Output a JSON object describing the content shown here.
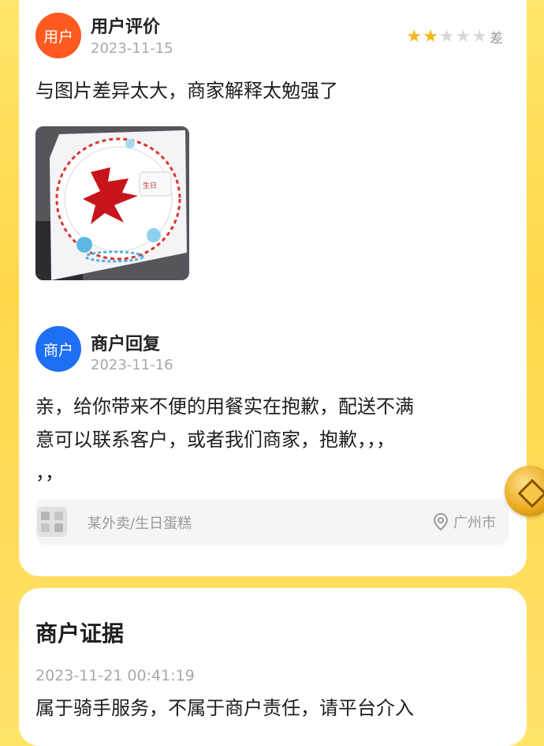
{
  "review": {
    "header": "用户评价",
    "avatar_label": "用户",
    "date": "2023-11-15",
    "rating": 2,
    "rating_max": 5,
    "rating_label": "差",
    "content": "与图片差异太大，商家解释太勉强了"
  },
  "reply": {
    "header": "商户回复",
    "avatar_label": "商户",
    "date": "2023-11-16",
    "content_line1": "亲，给你带来不便的用餐实在抱歉，配送不满",
    "content_line2": "意可以联系客户，或者我们商家，抱歉，，，",
    "content_line3": "，，"
  },
  "footer": {
    "category": "某外卖/生日蛋糕",
    "location": "广州市"
  },
  "evidence": {
    "title": "商户证据",
    "timestamp": "2023-11-21 00:41:19",
    "content": "属于骑手服务，不属于商户责任，请平台介入"
  },
  "colors": {
    "background": "#ffd84a",
    "user_avatar": "#ff5a1f",
    "merchant_avatar": "#1f6ff5",
    "star": "#f5b51c"
  }
}
